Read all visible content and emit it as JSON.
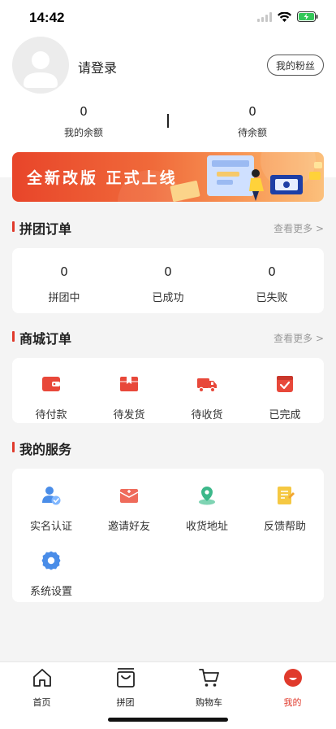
{
  "status_bar": {
    "time": "14:42"
  },
  "profile": {
    "login_label": "请登录",
    "fans_button": "我的粉丝"
  },
  "balance": [
    {
      "value": "0",
      "label": "我的余额"
    },
    {
      "value": "0",
      "label": "待余额"
    }
  ],
  "banner": {
    "text": "全新改版 正式上线"
  },
  "group_orders": {
    "title": "拼团订单",
    "more": "查看更多 >",
    "stats": [
      {
        "value": "0",
        "label": "拼团中"
      },
      {
        "value": "0",
        "label": "已成功"
      },
      {
        "value": "0",
        "label": "已失败"
      }
    ]
  },
  "mall_orders": {
    "title": "商城订单",
    "more": "查看更多 >",
    "items": [
      {
        "label": "待付款",
        "icon": "wallet-icon"
      },
      {
        "label": "待发货",
        "icon": "package-icon"
      },
      {
        "label": "待收货",
        "icon": "truck-icon"
      },
      {
        "label": "已完成",
        "icon": "check-box-icon"
      }
    ]
  },
  "services": {
    "title": "我的服务",
    "items": [
      {
        "label": "实名认证",
        "icon": "verified-user-icon"
      },
      {
        "label": "邀请好友",
        "icon": "invite-mail-icon"
      },
      {
        "label": "收货地址",
        "icon": "location-pin-icon"
      },
      {
        "label": "反馈帮助",
        "icon": "feedback-note-icon"
      },
      {
        "label": "系统设置",
        "icon": "settings-gear-icon"
      }
    ]
  },
  "tabbar": [
    {
      "label": "首页",
      "icon": "home-icon"
    },
    {
      "label": "拼团",
      "icon": "shopping-bag-icon"
    },
    {
      "label": "购物车",
      "icon": "cart-icon"
    },
    {
      "label": "我的",
      "icon": "profile-icon",
      "active": true
    }
  ],
  "colors": {
    "accent": "#e03a2c",
    "background": "#f4f4f4",
    "card": "#ffffff"
  }
}
